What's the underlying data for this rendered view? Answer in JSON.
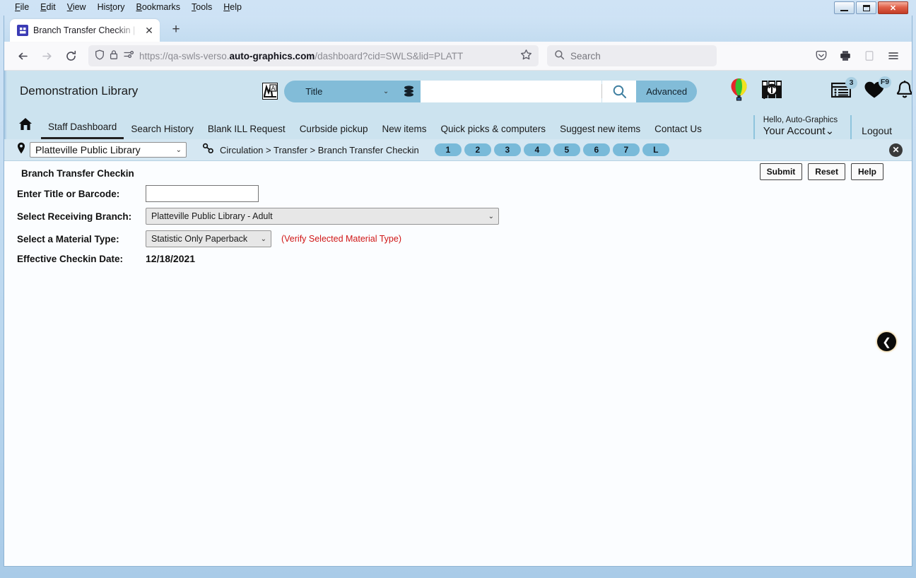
{
  "window": {
    "menus": [
      "File",
      "Edit",
      "View",
      "History",
      "Bookmarks",
      "Tools",
      "Help"
    ],
    "minimize_label": "Minimize",
    "maximize_label": "Maximize",
    "close_label": "✕"
  },
  "browser": {
    "tab_title": "Branch Transfer Checkin | SWLS",
    "tab_close": "✕",
    "new_tab": "+",
    "back": "←",
    "forward": "→",
    "reload": "⟳",
    "url_prefix": "https://qa-swls-verso.",
    "url_domain": "auto-graphics.com",
    "url_suffix": "/dashboard?cid=SWLS&lid=PLATT",
    "url_full": "https://qa-swls-verso.auto-graphics.com/dashboard?cid=SWLS&lid=PLATT",
    "search_placeholder": "Search",
    "bookmark_star": "☆"
  },
  "app": {
    "library_name": "Demonstration Library",
    "search": {
      "scope_selected": "Title",
      "query_value": "",
      "advanced_label": "Advanced"
    },
    "header_badges": {
      "list_count": "3",
      "favorites_key": "F9"
    },
    "account": {
      "hello": "Hello, Auto-Graphics",
      "name": "Your Account",
      "caret": "⌄",
      "logout": "Logout"
    },
    "nav": [
      {
        "label": "Staff Dashboard",
        "active": true
      },
      {
        "label": "Search History",
        "active": false
      },
      {
        "label": "Blank ILL Request",
        "active": false
      },
      {
        "label": "Curbside pickup",
        "active": false
      },
      {
        "label": "New items",
        "active": false
      },
      {
        "label": "Quick picks & computers",
        "active": false
      },
      {
        "label": "Suggest new items",
        "active": false
      },
      {
        "label": "Contact Us",
        "active": false
      }
    ]
  },
  "context": {
    "branch_selected": "Platteville Public Library",
    "breadcrumb": "Circulation > Transfer > Branch Transfer Checkin",
    "step_pills": [
      "1",
      "2",
      "3",
      "4",
      "5",
      "6",
      "7",
      "L"
    ],
    "close_label": "✕"
  },
  "form": {
    "title": "Branch Transfer Checkin",
    "buttons": {
      "submit": "Submit",
      "reset": "Reset",
      "help": "Help"
    },
    "fields": {
      "barcode_label": "Enter Title or Barcode:",
      "barcode_value": "",
      "receiving_branch_label": "Select Receiving Branch:",
      "receiving_branch_value": "Platteville Public Library - Adult",
      "material_type_label": "Select a Material Type:",
      "material_type_value": "Statistic Only Paperback",
      "verify_note": "(Verify Selected Material Type)",
      "effective_date_label": "Effective Checkin Date:",
      "effective_date_value": "12/18/2021"
    },
    "collapse_label": "❮"
  },
  "colors": {
    "app_header": "#cce3ef",
    "accent": "#82bcd8",
    "pill": "#79bad9",
    "error_text": "#d01616",
    "ctx_bar": "#d5e7f2"
  }
}
